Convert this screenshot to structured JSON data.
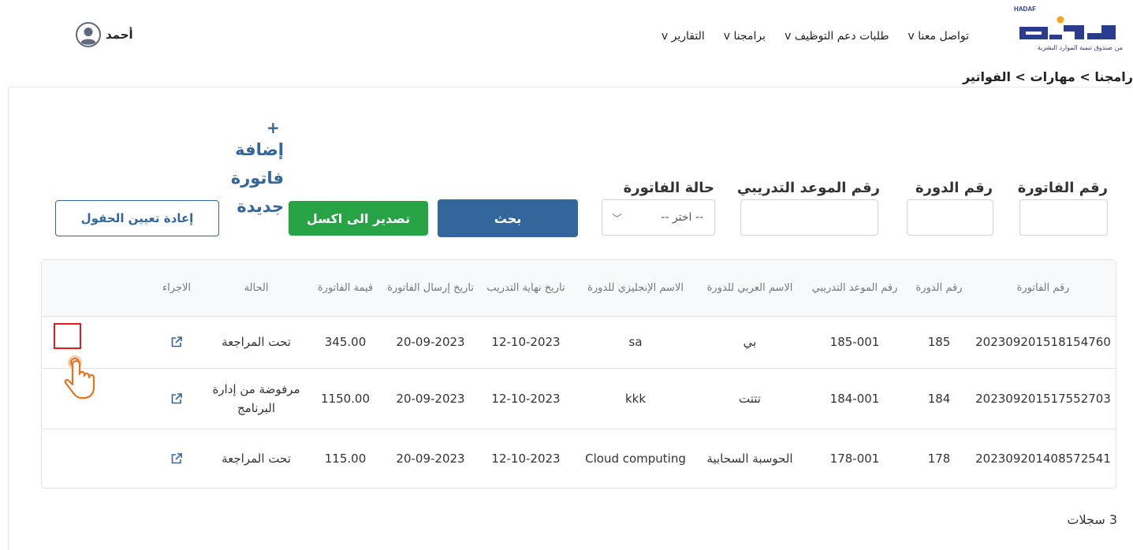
{
  "header": {
    "logo_brand": "HADAF",
    "logo_wordmark": "هدف",
    "logo_subtitle": "من صندوق تنمية الموارد البشرية",
    "nav": [
      {
        "label": "تواصل معنا v"
      },
      {
        "label": "طلبات دعم التوظيف v"
      },
      {
        "label": "برامجنا v"
      },
      {
        "label": "التقارير v"
      }
    ],
    "user_name": "أحمد",
    "avatar_icon": "user-avatar-icon"
  },
  "breadcrumb": "رامجنا > مهارات > الفواتير",
  "filters": {
    "invoice_number_label": "رقم الفاتورة",
    "course_number_label": "رقم الدورة",
    "schedule_number_label": "رقم الموعد التدريبي",
    "status_label": "حالة الفاتورة",
    "status_selected": "-- اختر --",
    "status_chevron": "﹀"
  },
  "buttons": {
    "search": "بحث",
    "export_excel": "تصدير الى اكسل",
    "add_plus": "+",
    "add_invoice": "إضافة فاتورة جديدة",
    "reset": "إعادة تعيين الحقول"
  },
  "table": {
    "headers": {
      "invoice_number": "رقم الفاتورة",
      "course_number": "رقم الدورة",
      "schedule_number": "رقم الموعد التدريبي",
      "arabic_name": "الاسم العربي للدورة",
      "english_name": "الاسم الإنجليزي للدورة",
      "end_date": "تاريخ نهاية التدريب",
      "sent_date": "تاريخ إرسال الفاتورة",
      "value": "قيمة الفاتورة",
      "status": "الحالة",
      "action": "الاجراء"
    },
    "rows": [
      {
        "invoice_number": "202309201518154760",
        "course_number": "185",
        "schedule_number": "185-001",
        "arabic_name": "بي",
        "english_name": "sa",
        "end_date": "12-10-2023",
        "sent_date": "20-09-2023",
        "value": "345.00",
        "status": "تحت المراجعة",
        "action_icon": "open-external-icon"
      },
      {
        "invoice_number": "202309201517552703",
        "course_number": "184",
        "schedule_number": "184-001",
        "arabic_name": "تتتت",
        "english_name": "kkk",
        "end_date": "12-10-2023",
        "sent_date": "20-09-2023",
        "value": "1150.00",
        "status": "مرفوضة من إدارة البرنامج",
        "action_icon": "open-external-icon"
      },
      {
        "invoice_number": "202309201408572541",
        "course_number": "178",
        "schedule_number": "178-001",
        "arabic_name": "الحوسبة السحابية",
        "english_name": "Cloud computing",
        "end_date": "12-10-2023",
        "sent_date": "20-09-2023",
        "value": "115.00",
        "status": "تحت المراجعة",
        "action_icon": "open-external-icon"
      }
    ]
  },
  "records_count": "3 سجلات",
  "colors": {
    "primary": "#33669a",
    "success": "#27a244",
    "highlight": "#e01b1b",
    "brand_blue": "#2b3b8f",
    "brand_orange": "#f5a623"
  }
}
